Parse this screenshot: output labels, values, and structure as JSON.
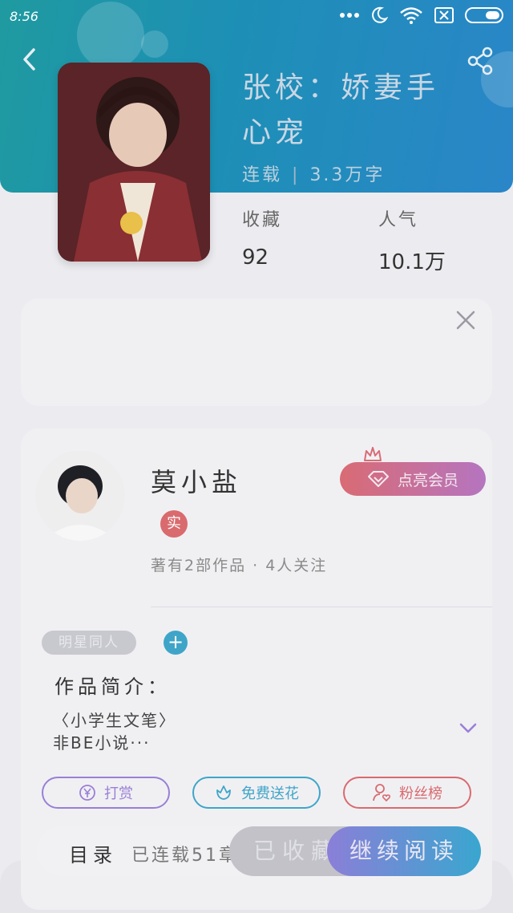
{
  "status_bar": {
    "time": "8:56"
  },
  "book": {
    "title": "张校：娇妻手心宠",
    "status": "连载",
    "word_count": "3.3万字",
    "collect_label": "收藏",
    "collect_value": "92",
    "popularity_label": "人气",
    "popularity_value": "10.1万"
  },
  "author": {
    "name": "莫小盐",
    "verified_badge": "实",
    "works": "著有2部作品 · 4人关注",
    "vip_label": "点亮会员"
  },
  "tags": {
    "first": "明星同人",
    "add": "+"
  },
  "intro": {
    "title": "作品简介：",
    "line1": "〈小学生文笔〉",
    "line2": "非BE小说···"
  },
  "actions": {
    "reward": "打赏",
    "flower": "免费送花",
    "fans": "粉丝榜"
  },
  "bottom": {
    "toc": "目录",
    "chapters": "已连载51章",
    "collected": "已收藏",
    "continue": "继续阅读"
  },
  "colors": {
    "header": "#1d8fb6",
    "accent_blue": "#3fa5c8",
    "accent_purple": "#9a7fd6",
    "accent_red": "#d96a6e"
  }
}
